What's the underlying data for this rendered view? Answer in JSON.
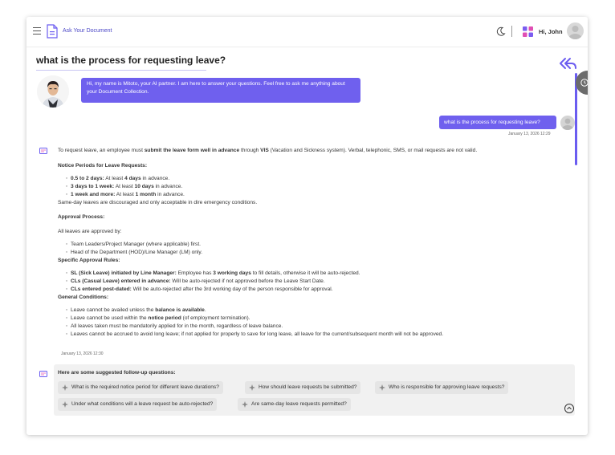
{
  "header": {
    "app_title": "Ask Your Document",
    "greeting": "Hi, John"
  },
  "page_title": "what is the process for requesting leave?",
  "bot_intro": "Hi, my name is Mitoto, your AI partner. I am here to answer your questions. Feel free to ask me anything about your Document Collection.",
  "user_message": {
    "text": "what is the process for requesting leave?",
    "time": "January 13, 2026 12:29"
  },
  "answer": {
    "intro_pre": "To request leave, an employee must ",
    "intro_bold": "submit the leave form well in advance",
    "intro_mid": " through ",
    "intro_bold2": "VIS",
    "intro_post": " (Vacation and Sickness system). Verbal, telephonic, SMS, or mail requests are not valid.",
    "notice_heading": "Notice Periods for Leave Requests:",
    "notice_items": [
      {
        "bold": "0.5 to 2 days:",
        "pre": " At least ",
        "bold2": "4 days",
        "post": " in advance."
      },
      {
        "bold": "3 days to 1 week:",
        "pre": " At least ",
        "bold2": "10 days",
        "post": " in advance."
      },
      {
        "bold": "1 week and more:",
        "pre": " At least ",
        "bold2": "1 month",
        "post": " in advance."
      }
    ],
    "same_day": "Same-day leaves are discouraged and only acceptable in dire emergency conditions.",
    "approval_heading": "Approval Process:",
    "approval_intro": "All leaves are approved by:",
    "approval_items": [
      "Team Leaders/Project Manager (where applicable) first.",
      "Head of the Department (HOD)/Line Manager (LM) only."
    ],
    "specific_heading": "Specific Approval Rules:",
    "specific_items": [
      {
        "bold": "SL (Sick Leave) initiated by Line Manager:",
        "pre": " Employee has ",
        "bold2": "3 working days",
        "post": " to fill details, otherwise it will be auto-rejected."
      },
      {
        "bold": "CLs (Casual Leave) entered in advance:",
        "pre": " Will be auto-rejected if not approved before the Leave Start Date.",
        "bold2": "",
        "post": ""
      },
      {
        "bold": "CLs entered post-dated:",
        "pre": " Will be auto-rejected after the 3rd working day of the person responsible for approval.",
        "bold2": "",
        "post": ""
      }
    ],
    "general_heading": "General Conditions:",
    "general_items": [
      {
        "pre": "Leave cannot be availed unless the ",
        "bold": "balance is available",
        "post": "."
      },
      {
        "pre": "Leave cannot be used within the ",
        "bold": "notice period",
        "post": " (of employment termination)."
      },
      {
        "pre": "All leaves taken must be mandatorily applied for in the month, regardless of leave balance.",
        "bold": "",
        "post": ""
      },
      {
        "pre": "Leaves cannot be accrued to avoid long leave; if not applied for properly to save for long leave, all leave for the current/subsequent month will not be approved.",
        "bold": "",
        "post": ""
      }
    ],
    "time": "January 13, 2026 12:30"
  },
  "suggestions": {
    "title": "Here are some suggested follow-up questions:",
    "items": [
      "What is the required notice period for different leave durations?",
      "How should leave requests be submitted?",
      "Who is responsible for approving leave requests?",
      "Under what conditions will a leave request be auto-rejected?",
      "Are same-day leave requests permitted?"
    ]
  },
  "colors": {
    "accent": "#6f60ee",
    "title_link": "#4b47c6"
  }
}
